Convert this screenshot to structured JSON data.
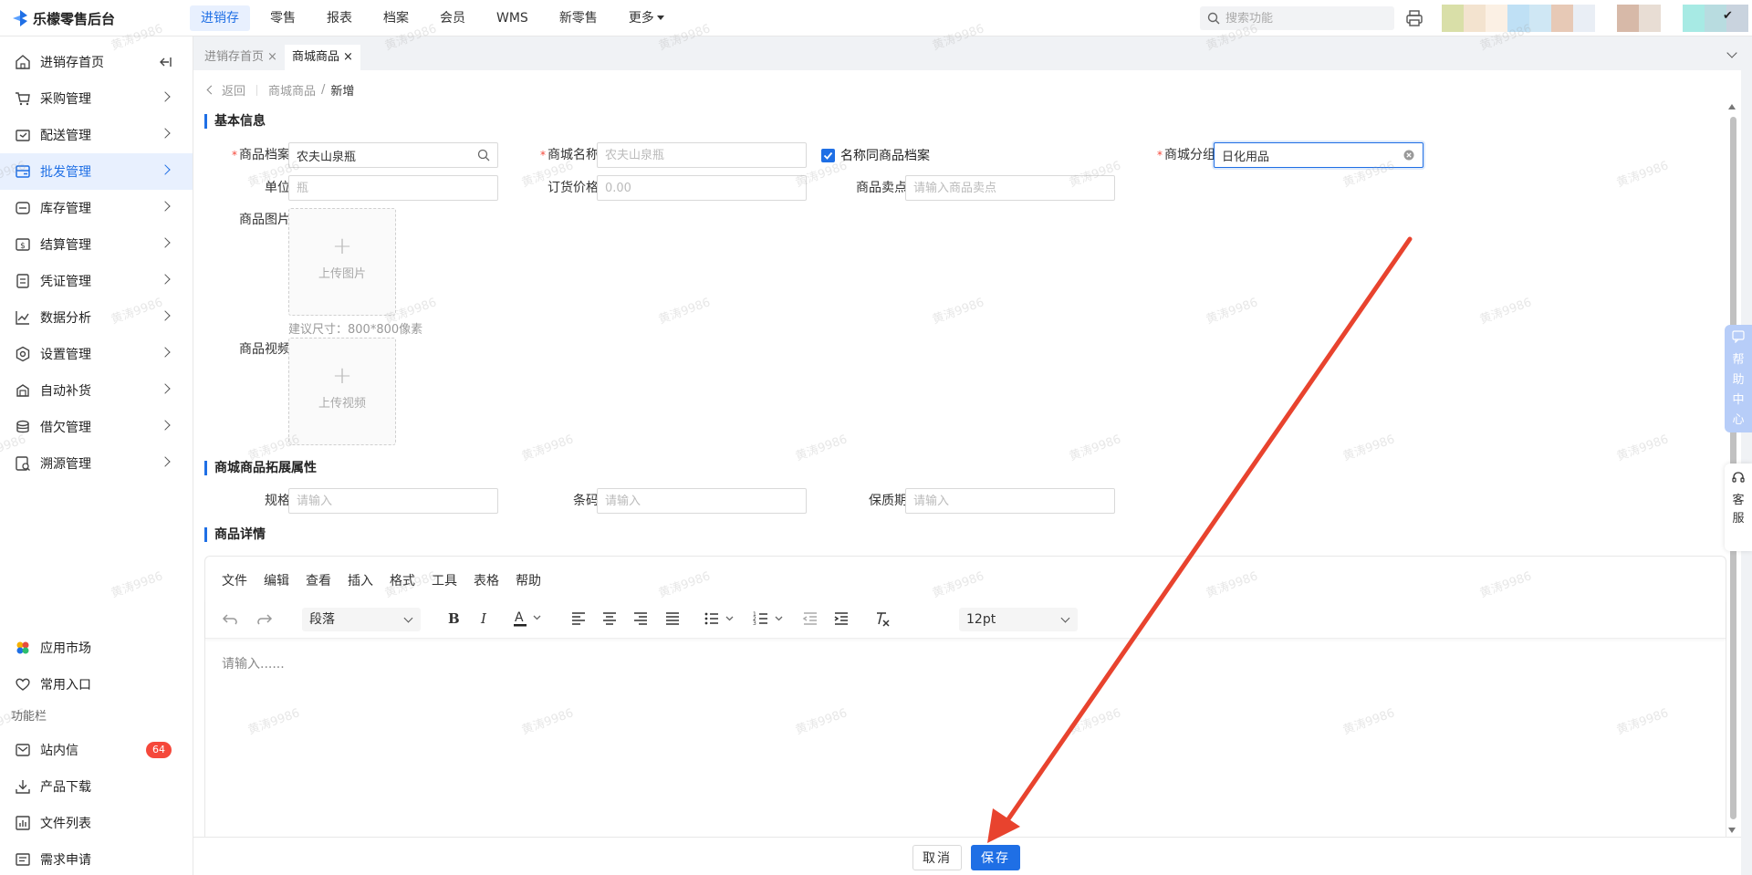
{
  "app": {
    "title": "乐檬零售后台"
  },
  "topnav": {
    "items": [
      {
        "label": "进销存",
        "active": true
      },
      {
        "label": "零售"
      },
      {
        "label": "报表"
      },
      {
        "label": "档案"
      },
      {
        "label": "会员"
      },
      {
        "label": "WMS"
      },
      {
        "label": "新零售"
      },
      {
        "label": "更多"
      }
    ],
    "search_placeholder": "搜索功能"
  },
  "sidebar": {
    "items": [
      {
        "label": "进销存首页",
        "icon": "home-icon"
      },
      {
        "label": "采购管理",
        "icon": "cart-icon"
      },
      {
        "label": "配送管理",
        "icon": "delivery-icon"
      },
      {
        "label": "批发管理",
        "icon": "wholesale-icon",
        "active": true
      },
      {
        "label": "库存管理",
        "icon": "inventory-icon"
      },
      {
        "label": "结算管理",
        "icon": "settlement-icon"
      },
      {
        "label": "凭证管理",
        "icon": "voucher-icon"
      },
      {
        "label": "数据分析",
        "icon": "chart-icon"
      },
      {
        "label": "设置管理",
        "icon": "settings-icon"
      },
      {
        "label": "自动补货",
        "icon": "replenish-icon"
      },
      {
        "label": "借欠管理",
        "icon": "debt-icon"
      },
      {
        "label": "溯源管理",
        "icon": "trace-icon"
      }
    ],
    "bottom": {
      "app_market": "应用市场",
      "favorites": "常用入口",
      "section": "功能栏",
      "messages": "站内信",
      "messages_count": "64",
      "downloads": "产品下载",
      "file_list": "文件列表",
      "requests": "需求申请"
    }
  },
  "tabs": [
    {
      "label": "进销存首页",
      "active": false
    },
    {
      "label": "商城商品",
      "active": true
    }
  ],
  "breadcrumb": {
    "back": "返回",
    "parent": "商城商品",
    "current": "新增"
  },
  "form": {
    "section_basic": "基本信息",
    "product_file_label": "商品档案",
    "product_file_value": "农夫山泉瓶",
    "mall_name_label": "商城名称",
    "mall_name_placeholder": "农夫山泉瓶",
    "same_name_checkbox": "名称同商品档案",
    "mall_group_label": "商城分组",
    "mall_group_value": "日化用品",
    "unit_label": "单位",
    "unit_placeholder": "瓶",
    "order_price_label": "订货价格",
    "order_price_placeholder": "0.00",
    "selling_point_label": "商品卖点",
    "selling_point_placeholder": "请输入商品卖点",
    "image_label": "商品图片",
    "image_upload": "上传图片",
    "image_hint": "建议尺寸：800*800像素",
    "video_label": "商品视频",
    "video_upload": "上传视频",
    "section_ext": "商城商品拓展属性",
    "spec_label": "规格",
    "spec_placeholder": "请输入",
    "barcode_label": "条码",
    "barcode_placeholder": "请输入",
    "shelf_life_label": "保质期",
    "shelf_life_placeholder": "请输入",
    "section_detail": "商品详情"
  },
  "editor": {
    "menu": [
      "文件",
      "编辑",
      "查看",
      "插入",
      "格式",
      "工具",
      "表格",
      "帮助"
    ],
    "block_format": "段落",
    "font_size": "12pt",
    "placeholder": "请输入......"
  },
  "footer": {
    "cancel": "取消",
    "save": "保存"
  },
  "side_tabs": {
    "help": "帮助中心",
    "service": "客服"
  },
  "watermark": "黄涛9986",
  "colors": {
    "primary": "#1f6fe5",
    "danger": "#f5483b",
    "annotation_arrow": "#e8432e"
  }
}
